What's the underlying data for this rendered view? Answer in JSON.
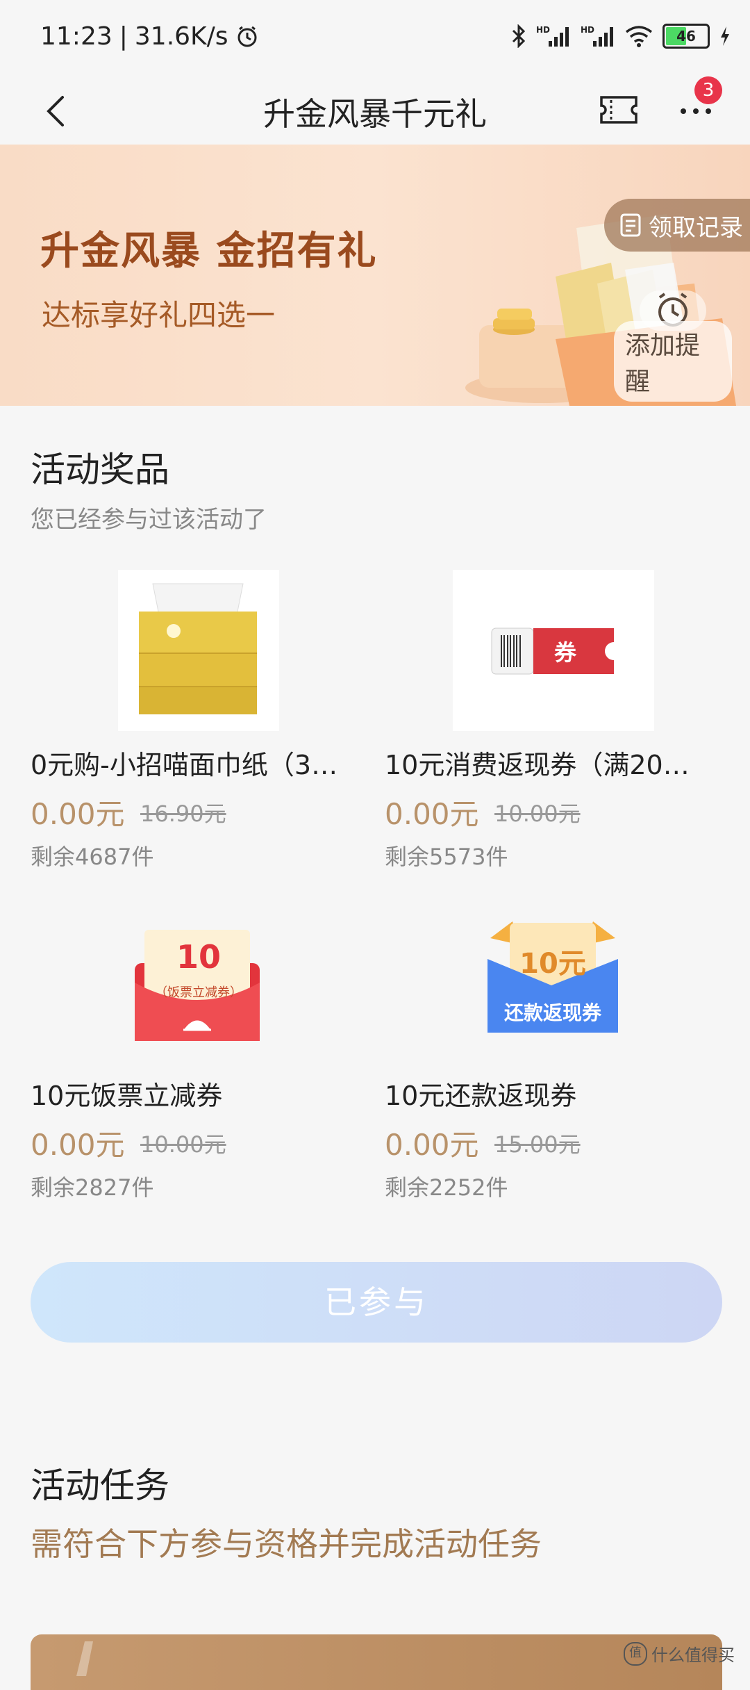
{
  "status_bar": {
    "time": "11:23",
    "net_speed": "31.6K/s",
    "signal1": "HD",
    "signal2": "HD",
    "battery": "46"
  },
  "nav": {
    "title": "升金风暴千元礼",
    "more_badge": "3"
  },
  "banner": {
    "title": "升金风暴 金招有礼",
    "subtitle": "达标享好礼四选一",
    "record_label": "领取记录",
    "remind_label": "添加提醒"
  },
  "prizes_section": {
    "title": "活动奖品",
    "subtitle": "您已经参与过该活动了"
  },
  "prizes": [
    {
      "name": "0元购-小招喵面巾纸（3…",
      "price": "0.00元",
      "original": "16.90元",
      "stock": "剩余4687件"
    },
    {
      "name": "10元消费返现券（满20…",
      "price": "0.00元",
      "original": "10.00元",
      "stock": "剩余5573件"
    },
    {
      "name": "10元饭票立减券",
      "price": "0.00元",
      "original": "10.00元",
      "stock": "剩余2827件"
    },
    {
      "name": "10元还款返现券",
      "price": "0.00元",
      "original": "15.00元",
      "stock": "剩余2252件"
    }
  ],
  "prize_images": {
    "coupon_text": "券",
    "meal_amount": "10",
    "meal_label": "（饭票立减券）",
    "repay_amount": "10元",
    "repay_label": "还款返现券"
  },
  "joined_button": "已参与",
  "tasks_section": {
    "title": "活动任务",
    "subtitle": "需符合下方参与资格并完成活动任务"
  },
  "watermark": "什么值得买",
  "colors": {
    "price": "#b8926a",
    "badge": "#e8344a",
    "accent": "#9a4a1e"
  }
}
